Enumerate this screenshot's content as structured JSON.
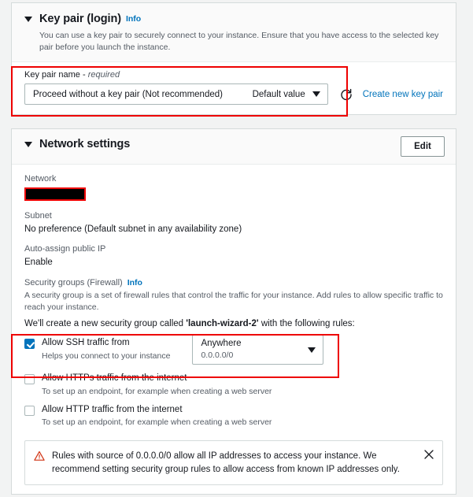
{
  "key_pair_section": {
    "title": "Key pair (login)",
    "info_label": "Info",
    "description": "You can use a key pair to securely connect to your instance. Ensure that you have access to the selected key pair before you launch the instance.",
    "field_label_text": "Key pair name - ",
    "field_label_required": "required",
    "select_value": "Proceed without a key pair (Not recommended)",
    "select_hint": "Default value",
    "refresh_icon": "refresh-icon",
    "create_link": "Create new key pair"
  },
  "network_section": {
    "title": "Network settings",
    "edit_label": "Edit",
    "network_label": "Network",
    "network_value_redacted": "",
    "subnet_label": "Subnet",
    "subnet_value": "No preference (Default subnet in any availability zone)",
    "auto_assign_label": "Auto-assign public IP",
    "auto_assign_value": "Enable",
    "security_groups_label": "Security groups (Firewall)",
    "security_groups_info": "Info",
    "security_groups_desc": "A security group is a set of firewall rules that control the traffic for your instance. Add rules to allow specific traffic to reach your instance.",
    "create_sg_prefix": "We'll create a new security group called ",
    "create_sg_name": "'launch-wizard-2'",
    "create_sg_suffix": " with the following rules:",
    "rules": [
      {
        "checked": true,
        "title": "Allow SSH traffic from",
        "subtitle": "Helps you connect to your instance",
        "source_value": "Anywhere",
        "source_sub": "0.0.0.0/0"
      },
      {
        "checked": false,
        "title": "Allow HTTPs traffic from the internet",
        "subtitle": "To set up an endpoint, for example when creating a web server"
      },
      {
        "checked": false,
        "title": "Allow HTTP traffic from the internet",
        "subtitle": "To set up an endpoint, for example when creating a web server"
      }
    ],
    "alert": {
      "icon": "warning-triangle-icon",
      "text": "Rules with source of 0.0.0.0/0 allow all IP addresses to access your instance. We recommend setting security group rules to allow access from known IP addresses only.",
      "close_icon": "close-icon"
    }
  },
  "annotations": {
    "highlight_color": "#ee0000"
  }
}
